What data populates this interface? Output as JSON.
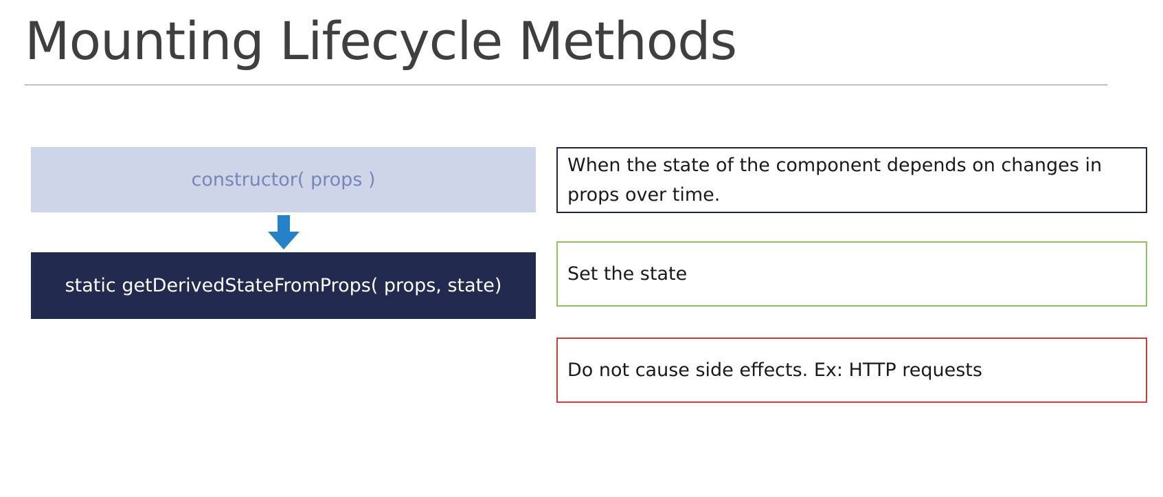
{
  "slide": {
    "title": "Mounting Lifecycle Methods"
  },
  "methods": [
    {
      "label": "constructor( props )"
    },
    {
      "label": "static getDerivedStateFromProps( props, state)"
    }
  ],
  "notes": [
    {
      "text": "When the state of the component depends on changes in props over time.",
      "border_color": "#1f2441"
    },
    {
      "text": "Set the state",
      "border_color": "#8cc459"
    },
    {
      "text": "Do not cause side effects. Ex: HTTP requests",
      "border_color": "#d83a33"
    }
  ],
  "colors": {
    "title_text": "#3f3f3f",
    "constructor_fill": "#cfd5e9",
    "constructor_text": "#7886b6",
    "derived_fill": "#222a4f",
    "derived_text": "#ffffff",
    "arrow": "#2581c8"
  },
  "icons": {
    "flow_arrow": "arrow-down-icon"
  }
}
